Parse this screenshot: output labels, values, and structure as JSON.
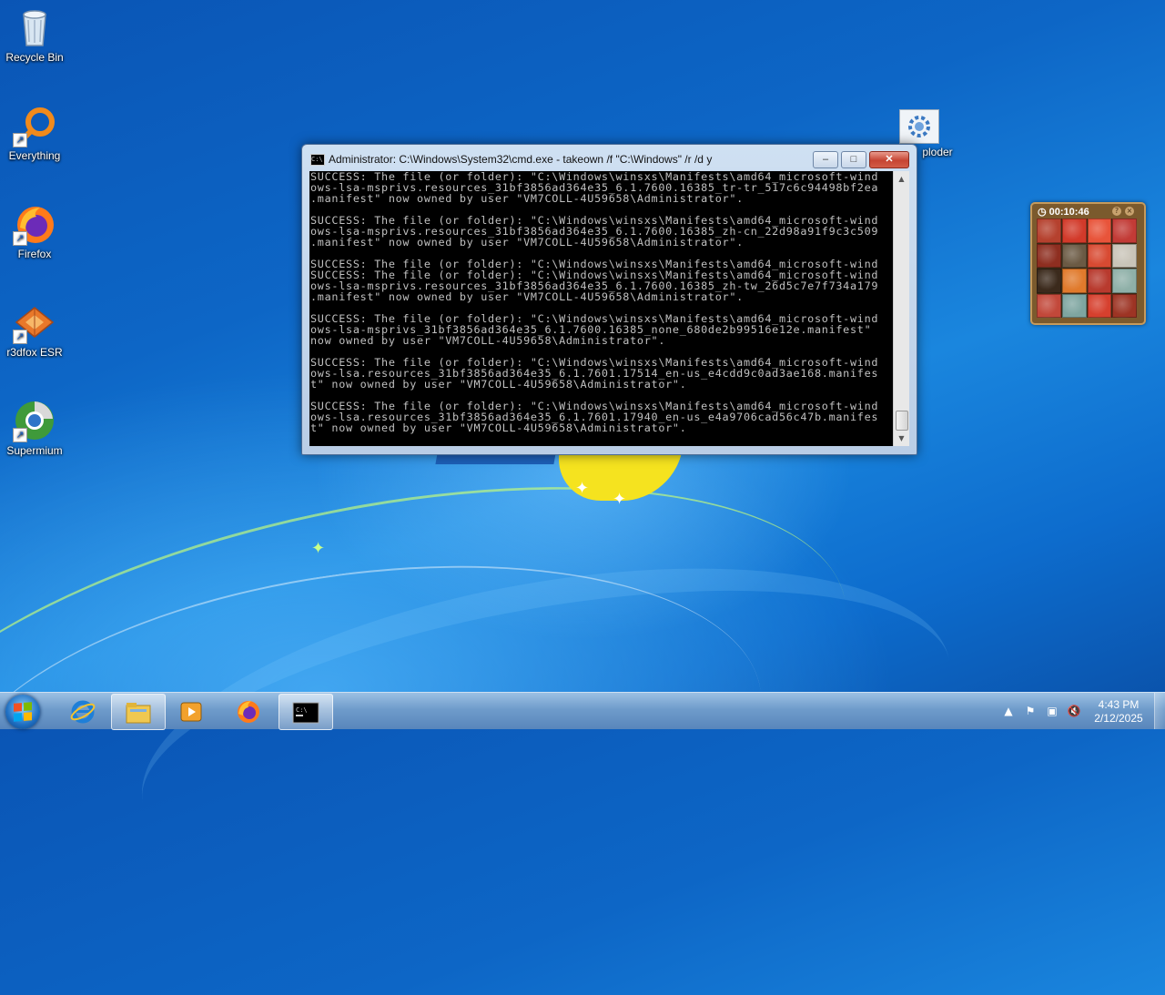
{
  "desktop": {
    "icons": [
      {
        "label": "Recycle Bin",
        "icon": "recycle-bin-icon"
      },
      {
        "label": "Everything",
        "icon": "everything-search-icon"
      },
      {
        "label": "Firefox",
        "icon": "firefox-icon"
      },
      {
        "label": "r3dfox ESR",
        "icon": "r3dfox-icon"
      },
      {
        "label": "Supermium",
        "icon": "supermium-icon"
      },
      {
        "label": "ploder",
        "icon": "gear-settings-icon"
      }
    ]
  },
  "cmd_window": {
    "title": "Administrator: C:\\Windows\\System32\\cmd.exe - takeown  /f \"C:\\Windows\" /r /d y",
    "buttons": {
      "minimize": "–",
      "maximize": "□",
      "close": "✕"
    },
    "console_lines": [
      "SUCCESS: The file (or folder): \"C:\\Windows\\winsxs\\Manifests\\amd64_microsoft-wind",
      "ows-lsa-msprivs.resources_31bf3856ad364e35_6.1.7600.16385_tr-tr_517c6c94498bf2ea",
      ".manifest\" now owned by user \"VM7COLL-4U59658\\Administrator\".",
      "",
      "SUCCESS: The file (or folder): \"C:\\Windows\\winsxs\\Manifests\\amd64_microsoft-wind",
      "ows-lsa-msprivs.resources_31bf3856ad364e35_6.1.7600.16385_zh-cn_22d98a91f9c3c509",
      ".manifest\" now owned by user \"VM7COLL-4U59658\\Administrator\".",
      "",
      "SUCCESS: The file (or folder): \"C:\\Windows\\winsxs\\Manifests\\amd64_microsoft-wind",
      "SUCCESS: The file (or folder): \"C:\\Windows\\winsxs\\Manifests\\amd64_microsoft-wind",
      "ows-lsa-msprivs.resources_31bf3856ad364e35_6.1.7600.16385_zh-tw_26d5c7e7f734a179",
      ".manifest\" now owned by user \"VM7COLL-4U59658\\Administrator\".",
      "",
      "SUCCESS: The file (or folder): \"C:\\Windows\\winsxs\\Manifests\\amd64_microsoft-wind",
      "ows-lsa-msprivs_31bf3856ad364e35_6.1.7600.16385_none_680de2b99516e12e.manifest\"",
      "now owned by user \"VM7COLL-4U59658\\Administrator\".",
      "",
      "SUCCESS: The file (or folder): \"C:\\Windows\\winsxs\\Manifests\\amd64_microsoft-wind",
      "ows-lsa.resources_31bf3856ad364e35_6.1.7601.17514_en-us_e4cdd9c0ad3ae168.manifes",
      "t\" now owned by user \"VM7COLL-4U59658\\Administrator\".",
      "",
      "SUCCESS: The file (or folder): \"C:\\Windows\\winsxs\\Manifests\\amd64_microsoft-wind",
      "ows-lsa.resources_31bf3856ad364e35_6.1.7601.17940_en-us_e4a9706cad56c47b.manifes",
      "t\" now owned by user \"VM7COLL-4U59658\\Administrator\"."
    ]
  },
  "gadget": {
    "timer": "00:10:46",
    "help_label": "?",
    "close_label": "×",
    "tile_colors": [
      "#b5412e",
      "#d23a2a",
      "#e8543a",
      "#c23b36",
      "#8e2e20",
      "#6b5a44",
      "#d84a32",
      "#c9c4b8",
      "#3b2a1c",
      "#e07a2c",
      "#b83a2e",
      "#8fb0a8",
      "#c2483a",
      "#7ea5a0",
      "#d6402e",
      "#9d3424"
    ]
  },
  "taskbar": {
    "items": [
      {
        "name": "internet-explorer",
        "icon": "internet-explorer-icon"
      },
      {
        "name": "file-explorer",
        "icon": "folder-icon"
      },
      {
        "name": "media-player",
        "icon": "media-player-icon"
      },
      {
        "name": "firefox",
        "icon": "firefox-icon"
      },
      {
        "name": "command-prompt",
        "icon": "cmd-icon"
      }
    ],
    "tray": {
      "time": "4:43 PM",
      "date": "2/12/2025"
    }
  }
}
